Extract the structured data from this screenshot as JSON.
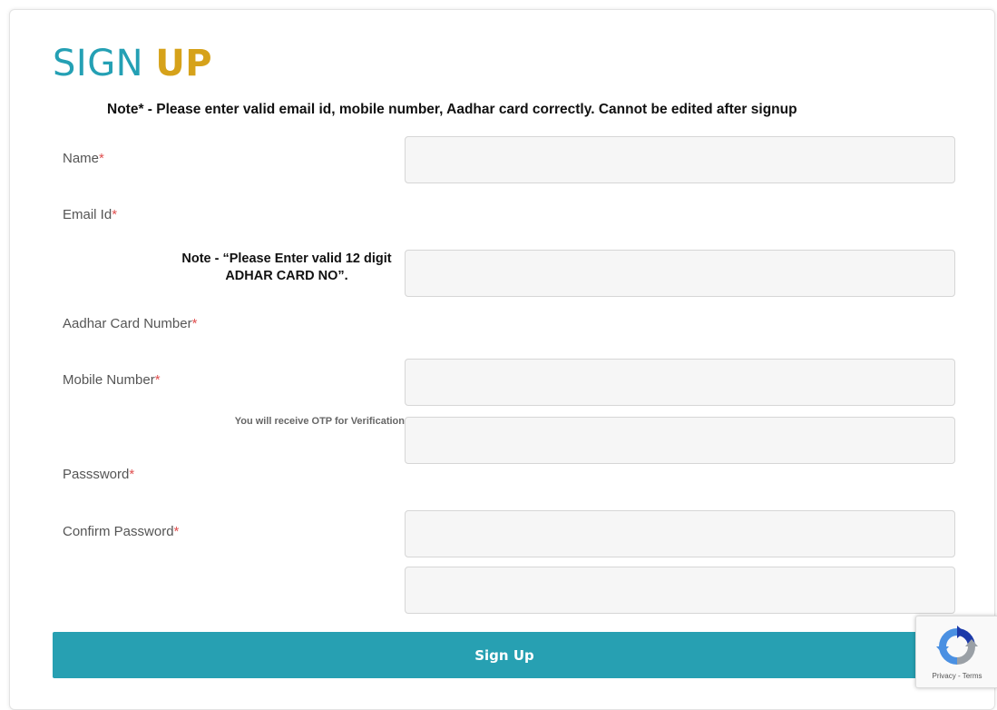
{
  "header": {
    "title_part1": "SIGN ",
    "title_part2": "UP",
    "note": "Note* - Please enter valid email id, mobile number, Aadhar card correctly. Cannot be edited after signup"
  },
  "colors": {
    "title_primary": "#24a0b4",
    "title_accent": "#d6a21a",
    "button": "#27a0b2",
    "required": "#e05050"
  },
  "form": {
    "required_mark": "*",
    "name_label": "Name",
    "name_value": "",
    "email_label": "Email Id",
    "email_value": "",
    "aadhar_note": "Note - “Please Enter valid 12 digit ADHAR CARD NO”.",
    "aadhar_label": "Aadhar Card Number",
    "aadhar_value": "",
    "mobile_label": "Mobile Number",
    "mobile_value": "",
    "otp_note": "You will receive OTP for Verification",
    "password_label": "Passsword",
    "password_value": "",
    "confirm_password_label": "Confirm Password",
    "confirm_password_value": "",
    "submit_label": "Sign Up"
  },
  "recaptcha": {
    "icon": "recaptcha-icon",
    "terms": "Privacy - Terms"
  }
}
